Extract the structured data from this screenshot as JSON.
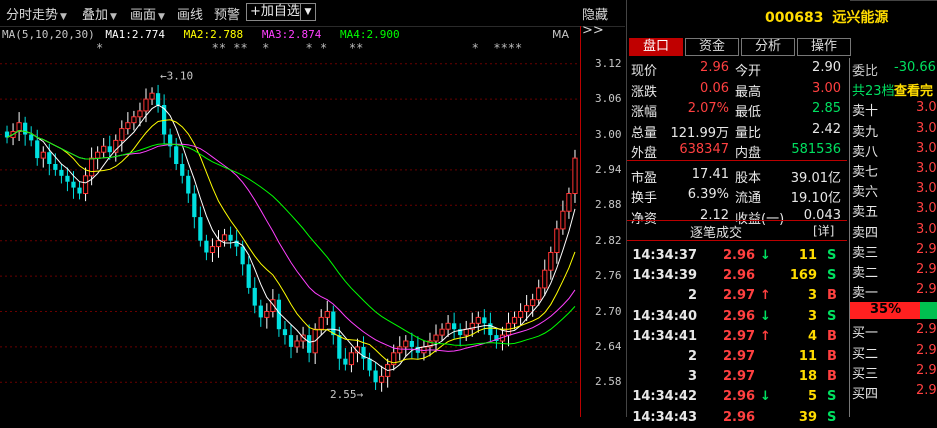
{
  "toolbar": {
    "items": [
      "分时走势",
      "叠加",
      "画面",
      "画线",
      "预警"
    ],
    "add_fav": "+加自选",
    "hide": "隐藏>>"
  },
  "ma_legend": {
    "label": "MA(5,10,20,30)",
    "ma1": "MA1:2.774",
    "ma2": "MA2:2.788",
    "ma3": "MA3:2.874",
    "ma4": "MA4:2.900",
    "tag": "MA"
  },
  "markers_text": "*               ** **  *     * *   **               *  ****",
  "chart_data": {
    "type": "candlestick",
    "price_axis": [
      "3.12",
      "3.06",
      "3.00",
      "2.94",
      "2.88",
      "2.82",
      "2.76",
      "2.70",
      "2.64",
      "2.58"
    ],
    "ylim": [
      2.55,
      3.15
    ],
    "annotations": [
      {
        "text": "3.10"
      },
      {
        "text": "2.55"
      }
    ],
    "series_colors": {
      "MA1": "#ffffff",
      "MA2": "#ffff00",
      "MA3": "#ff40ff",
      "MA4": "#00ff00"
    }
  },
  "stock": {
    "code": "000683",
    "name": "远兴能源"
  },
  "tabs": [
    "盘口",
    "资金",
    "分析",
    "操作"
  ],
  "quote": [
    {
      "l1": "现价",
      "v1": "2.96",
      "c1": "red",
      "l2": "今开",
      "v2": "2.90",
      "c2": "white"
    },
    {
      "l1": "涨跌",
      "v1": "0.06",
      "c1": "red",
      "l2": "最高",
      "v2": "3.00",
      "c2": "red"
    },
    {
      "l1": "涨幅",
      "v1": "2.07%",
      "c1": "red",
      "l2": "最低",
      "v2": "2.85",
      "c2": "green"
    },
    {
      "l1": "总量",
      "v1": "121.99万",
      "c1": "white",
      "l2": "量比",
      "v2": "2.42",
      "c2": "white"
    },
    {
      "l1": "外盘",
      "v1": "638347",
      "c1": "red",
      "l2": "内盘",
      "v2": "581536",
      "c2": "green"
    },
    {
      "l1": "市盈",
      "v1": "17.41",
      "c1": "white",
      "l2": "股本",
      "v2": "39.01亿",
      "c2": "white"
    },
    {
      "l1": "换手",
      "v1": "6.39%",
      "c1": "white",
      "l2": "流通",
      "v2": "19.10亿",
      "c2": "white"
    },
    {
      "l1": "净资",
      "v1": "2.12",
      "c1": "white",
      "l2": "收益(一)",
      "v2": "0.043",
      "c2": "white"
    }
  ],
  "ticks_title": "逐笔成交",
  "ticks_detail": "[详]",
  "ticks": [
    {
      "time": "14:34:37",
      "price": "2.96",
      "arrow": "↓",
      "dir": "green",
      "vol": "11",
      "bs": "S"
    },
    {
      "time": "14:34:39",
      "price": "2.96",
      "arrow": "",
      "dir": "white",
      "vol": "169",
      "bs": "S"
    },
    {
      "time": "2",
      "price": "2.97",
      "arrow": "↑",
      "dir": "red",
      "vol": "3",
      "bs": "B"
    },
    {
      "time": "14:34:40",
      "price": "2.96",
      "arrow": "↓",
      "dir": "green",
      "vol": "3",
      "bs": "S"
    },
    {
      "time": "14:34:41",
      "price": "2.97",
      "arrow": "↑",
      "dir": "red",
      "vol": "4",
      "bs": "B"
    },
    {
      "time": "2",
      "price": "2.97",
      "arrow": "",
      "dir": "red",
      "vol": "11",
      "bs": "B"
    },
    {
      "time": "3",
      "price": "2.97",
      "arrow": "",
      "dir": "red",
      "vol": "18",
      "bs": "B"
    },
    {
      "time": "14:34:42",
      "price": "2.96",
      "arrow": "↓",
      "dir": "green",
      "vol": "5",
      "bs": "S"
    },
    {
      "time": "14:34:43",
      "price": "2.96",
      "arrow": "",
      "dir": "white",
      "vol": "39",
      "bs": "S"
    }
  ],
  "book": {
    "weibi_label": "委比",
    "weibi_value": "-30.66",
    "view_all": "查看完",
    "total": "共23档",
    "sells": [
      {
        "l": "卖十",
        "p": "3.0"
      },
      {
        "l": "卖九",
        "p": "3.0"
      },
      {
        "l": "卖八",
        "p": "3.0"
      },
      {
        "l": "卖七",
        "p": "3.0"
      },
      {
        "l": "卖六",
        "p": "3.0"
      },
      {
        "l": "卖五",
        "p": "3.0"
      },
      {
        "l": "卖四",
        "p": "3.0"
      },
      {
        "l": "卖三",
        "p": "2.9"
      },
      {
        "l": "卖二",
        "p": "2.9"
      },
      {
        "l": "卖一",
        "p": "2.9"
      }
    ],
    "ratio_left": "35%",
    "buys": [
      {
        "l": "买一",
        "p": "2.9"
      },
      {
        "l": "买二",
        "p": "2.9"
      },
      {
        "l": "买三",
        "p": "2.9"
      },
      {
        "l": "买四",
        "p": "2.9"
      }
    ]
  }
}
